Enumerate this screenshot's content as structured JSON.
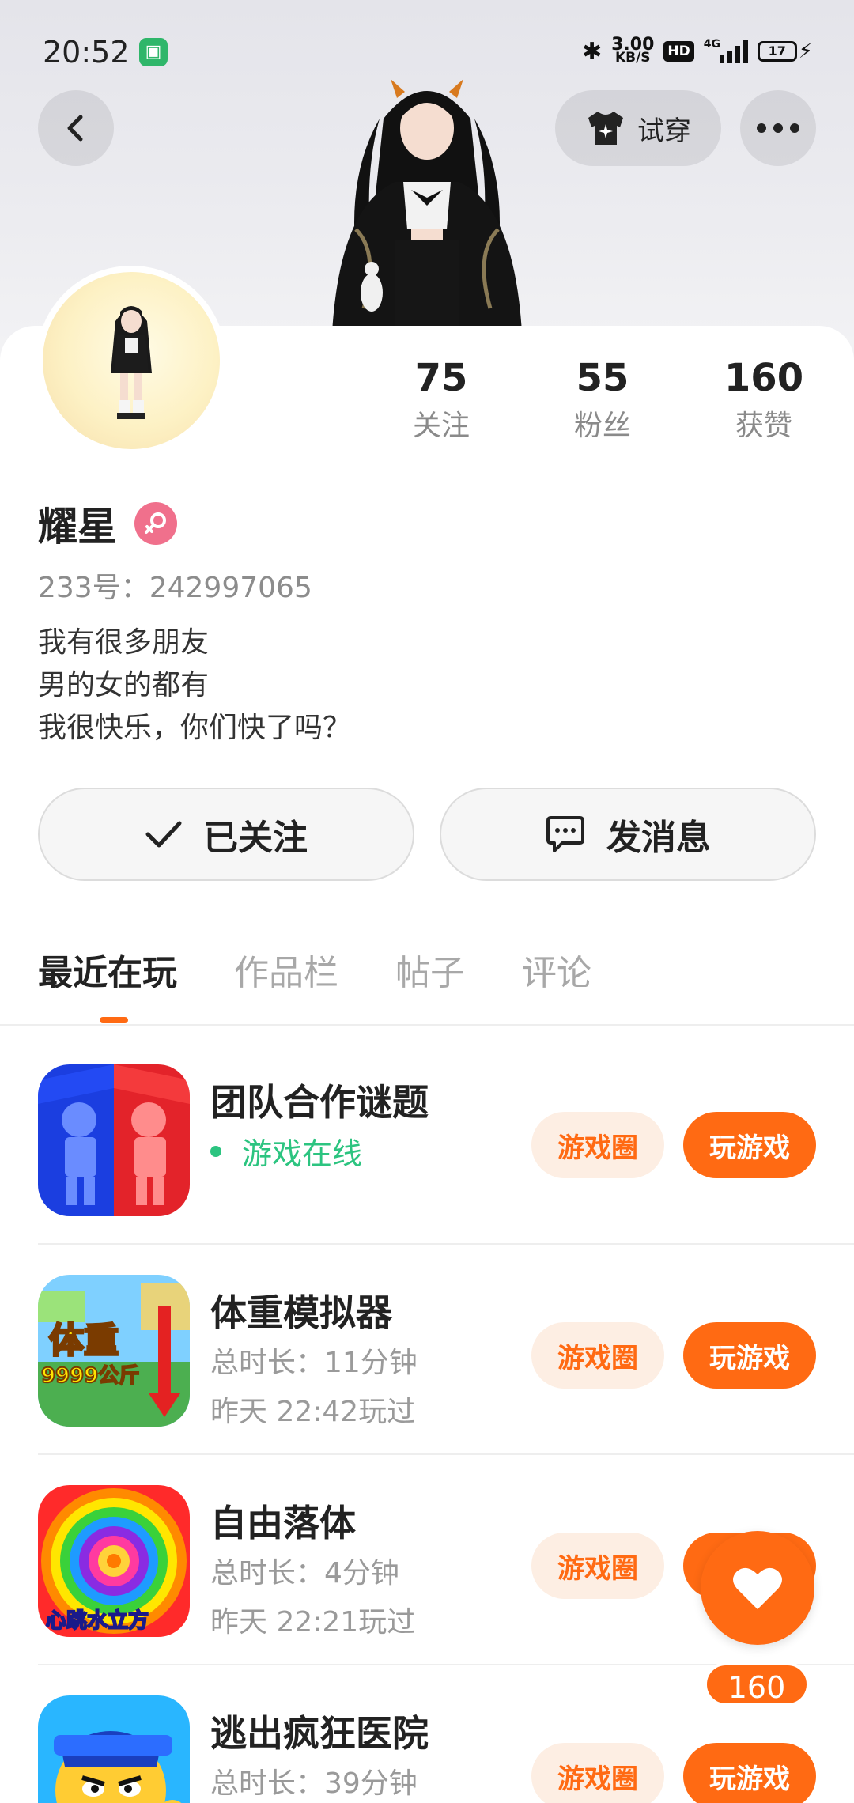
{
  "status_bar": {
    "time": "20:52",
    "network_speed": "3.00",
    "speed_unit": "KB/S",
    "hd_label": "HD",
    "network_type": "4G",
    "battery": "17"
  },
  "top_actions": {
    "try_on_label": "试穿"
  },
  "profile": {
    "name": "耀星",
    "uid_label": "233号：242997065",
    "bio_lines": [
      "我有很多朋友",
      "男的女的都有",
      "我很快乐，你们快了吗？"
    ],
    "stats": [
      {
        "value": "75",
        "label": "关注"
      },
      {
        "value": "55",
        "label": "粉丝"
      },
      {
        "value": "160",
        "label": "获赞"
      }
    ]
  },
  "actions": {
    "followed_label": "已关注",
    "message_label": "发消息"
  },
  "tabs": [
    {
      "label": "最近在玩",
      "active": true
    },
    {
      "label": "作品栏",
      "active": false
    },
    {
      "label": "帖子",
      "active": false
    },
    {
      "label": "评论",
      "active": false
    }
  ],
  "games": [
    {
      "title": "团队合作谜题",
      "status": "游戏在线",
      "circle_label": "游戏圈",
      "play_label": "玩游戏"
    },
    {
      "title": "体重模拟器",
      "duration": "总时长：11分钟",
      "last_played": "昨天 22:42玩过",
      "icon_text_1": "体重",
      "icon_text_2": "9999公斤",
      "circle_label": "游戏圈",
      "play_label": "玩游戏"
    },
    {
      "title": "自由落体",
      "duration": "总时长：4分钟",
      "last_played": "昨天 22:21玩过",
      "icon_text_1": "心跳水立方",
      "circle_label": "游戏圈",
      "play_label": "玩游戏"
    },
    {
      "title": "逃出疯狂医院",
      "duration": "总时长：39分钟",
      "circle_label": "游戏圈",
      "play_label": "玩游戏"
    }
  ],
  "like_float": {
    "count": "160"
  },
  "colors": {
    "accent": "#ff6a13",
    "online": "#2cc480",
    "gender_badge": "#f0708c"
  }
}
